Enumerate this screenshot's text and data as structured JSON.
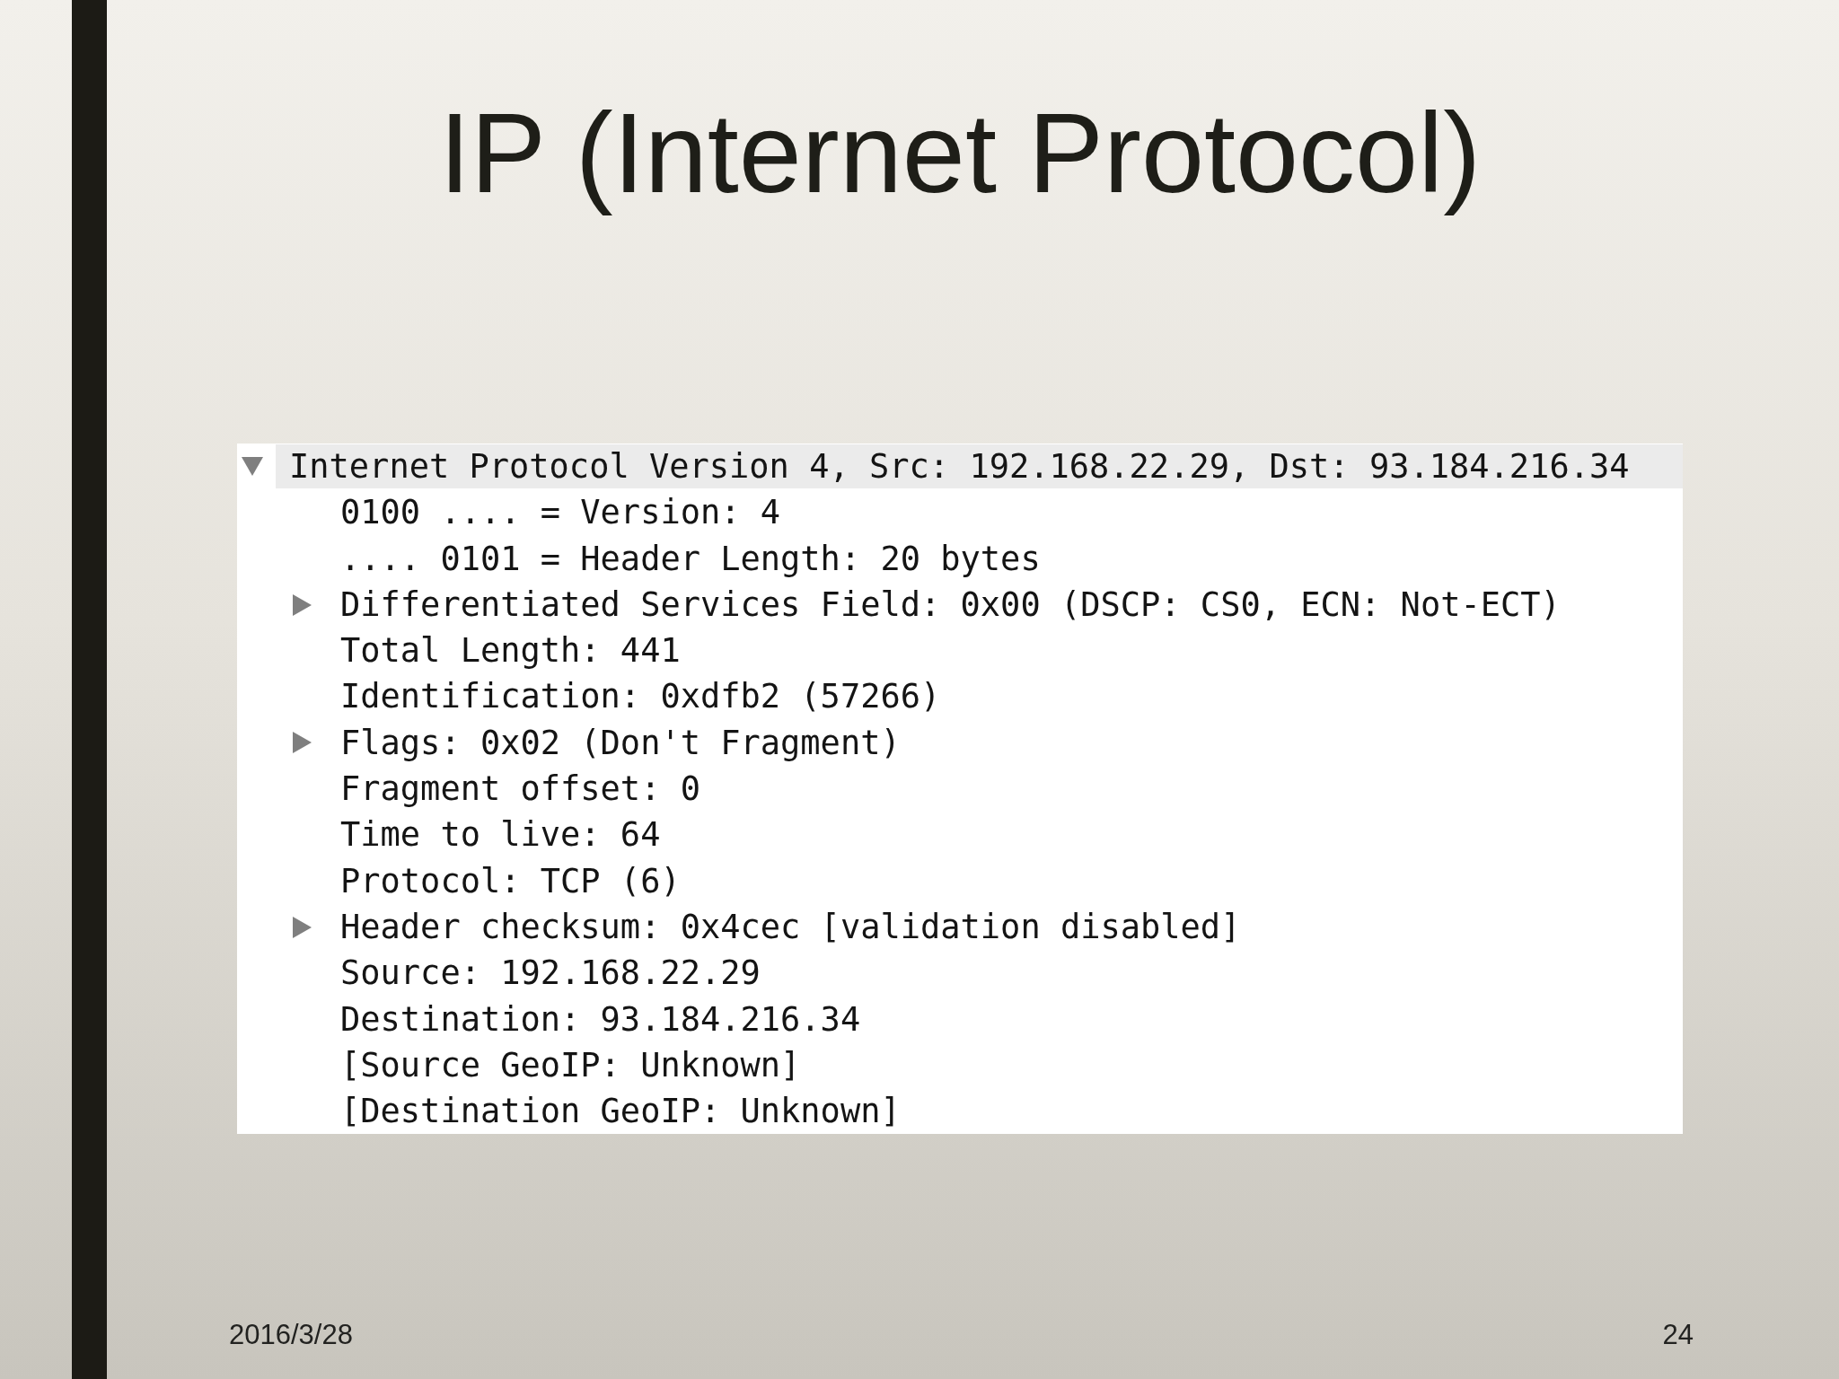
{
  "slide": {
    "title": "IP (Internet Protocol)"
  },
  "packet_details": {
    "tree": [
      {
        "kind": "group",
        "label": "Internet Protocol Version 4, Src: 192.168.22.29, Dst: 93.184.216.34",
        "expanded": true,
        "selected": true,
        "children": [
          {
            "kind": "field",
            "label": "0100 .... = Version: 4",
            "selected": false
          },
          {
            "kind": "field",
            "label": ".... 0101 = Header Length: 20 bytes",
            "selected": false
          },
          {
            "kind": "group",
            "label": "Differentiated Services Field: 0x00 (DSCP: CS0, ECN: Not-ECT)",
            "expanded": false,
            "selected": false
          },
          {
            "kind": "field",
            "label": "Total Length: 441",
            "selected": false
          },
          {
            "kind": "field",
            "label": "Identification: 0xdfb2 (57266)",
            "selected": false
          },
          {
            "kind": "group",
            "label": "Flags: 0x02 (Don't Fragment)",
            "expanded": false,
            "selected": false
          },
          {
            "kind": "field",
            "label": "Fragment offset: 0",
            "selected": false
          },
          {
            "kind": "field",
            "label": "Time to live: 64",
            "selected": false
          },
          {
            "kind": "field",
            "label": "Protocol: TCP (6)",
            "selected": false
          },
          {
            "kind": "group",
            "label": "Header checksum: 0x4cec [validation disabled]",
            "expanded": false,
            "selected": false
          },
          {
            "kind": "field",
            "label": "Source: 192.168.22.29",
            "selected": false
          },
          {
            "kind": "field",
            "label": "Destination: 93.184.216.34",
            "selected": false
          },
          {
            "kind": "field",
            "label": "[Source GeoIP: Unknown]",
            "selected": false
          },
          {
            "kind": "field",
            "label": "[Destination GeoIP: Unknown]",
            "selected": false
          }
        ]
      }
    ]
  },
  "footer": {
    "date": "2016/3/28",
    "page_number": "24"
  }
}
